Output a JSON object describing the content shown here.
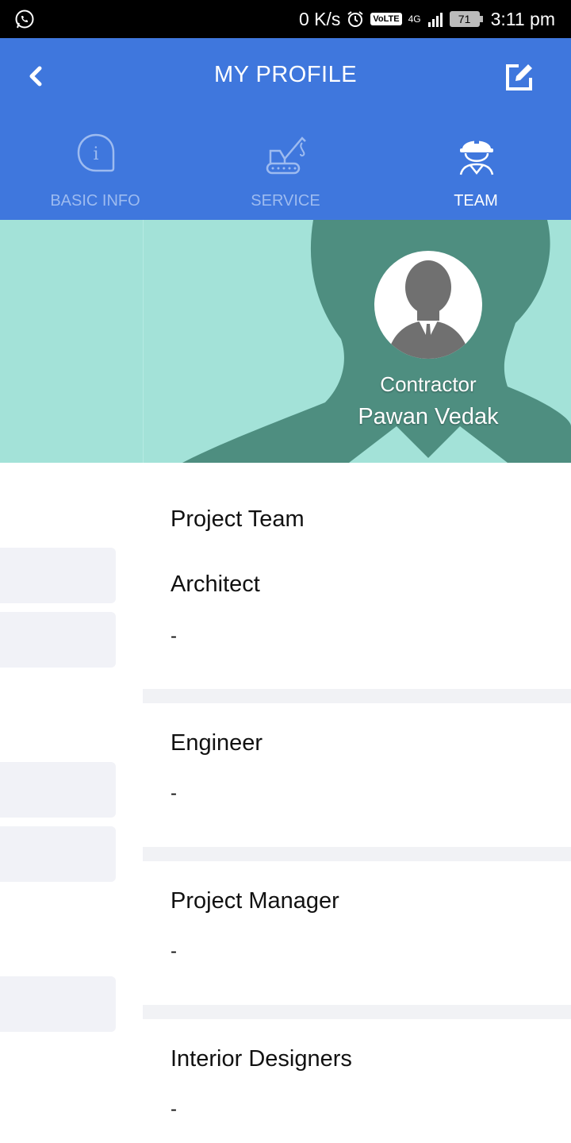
{
  "status_bar": {
    "speed": "0 K/s",
    "volte": "VoLTE",
    "network": "4G",
    "battery": "71",
    "time": "3:11 pm",
    "icons": [
      "whatsapp-icon",
      "alarm-icon",
      "signal-icon",
      "battery-icon"
    ]
  },
  "header": {
    "title": "MY PROFILE",
    "back_icon": "chevron-left-icon",
    "edit_icon": "edit-icon",
    "background_color": "#3f77dd"
  },
  "tabs": [
    {
      "label": "BASIC INFO",
      "icon": "info-icon",
      "active": false
    },
    {
      "label": "SERVICE",
      "icon": "excavator-icon",
      "active": false
    },
    {
      "label": "TEAM",
      "icon": "worker-helmet-icon",
      "active": true
    }
  ],
  "profile": {
    "role": "Contractor",
    "name": "Pawan Vedak",
    "hero_color": "#a3e2d8"
  },
  "content": {
    "title": "Project Team",
    "sections": [
      {
        "title": "Architect",
        "value": "-"
      },
      {
        "title": "Engineer",
        "value": "-"
      },
      {
        "title": "Project Manager",
        "value": "-"
      },
      {
        "title": "Interior Designers",
        "value": "-"
      }
    ]
  }
}
